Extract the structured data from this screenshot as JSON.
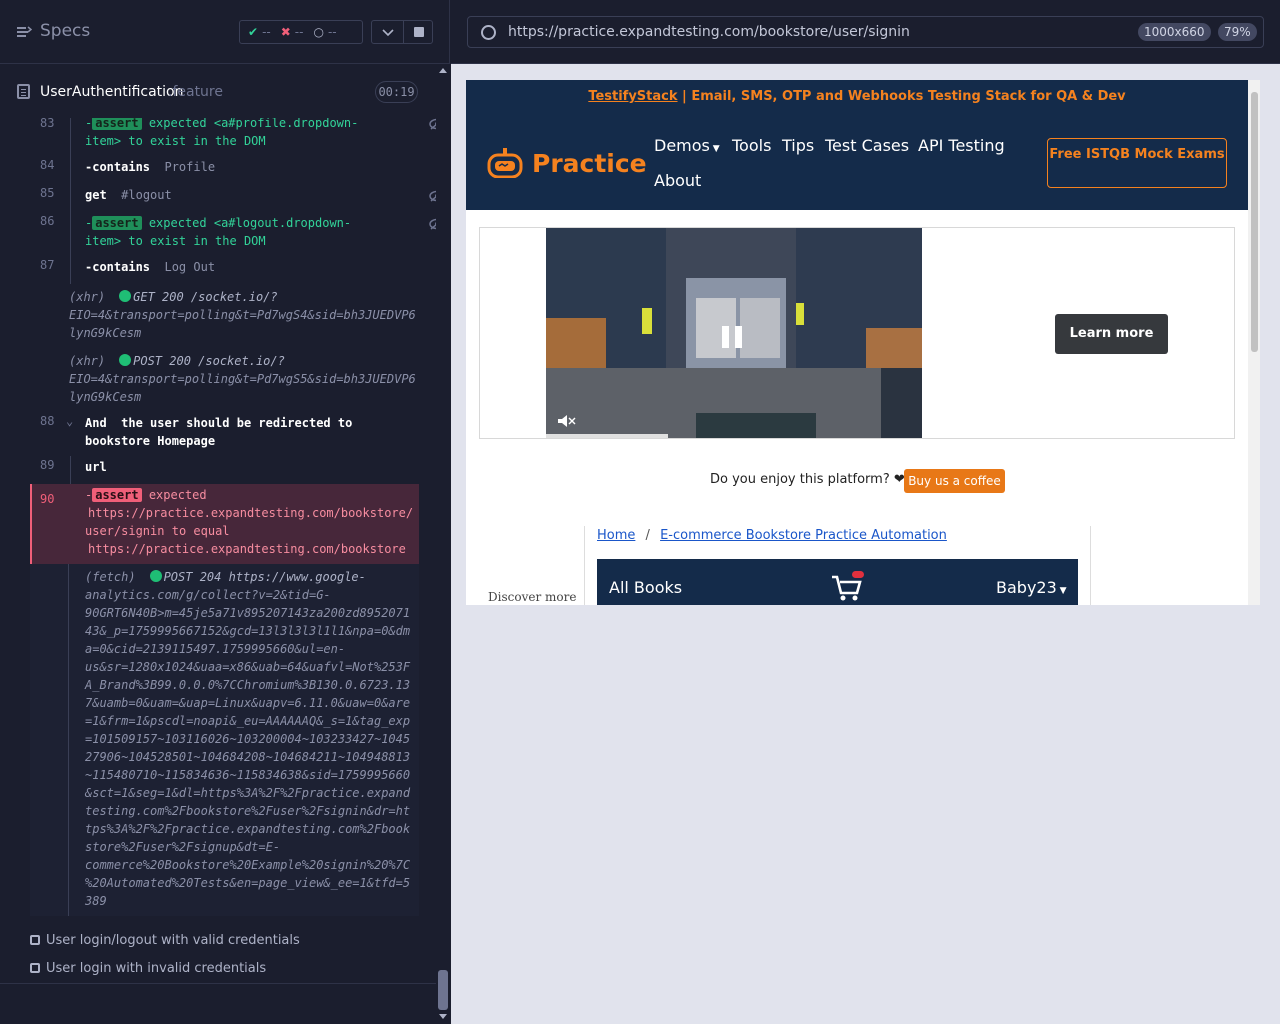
{
  "specs": {
    "title": "Specs",
    "passed": "--",
    "failed": "--",
    "pending": "--"
  },
  "file": {
    "name": "UserAuthentification",
    "ext": ".feature",
    "duration": "00:19"
  },
  "commands": [
    {
      "num": "83",
      "assert": "assert",
      "text": "expected",
      "code": "<a#profile.dropdown-",
      "code2": "item>",
      "tail": "to exist in the DOM"
    },
    {
      "num": "84",
      "cmd": "contains",
      "arg": "Profile"
    },
    {
      "num": "85",
      "cmd": "get",
      "arg": "#logout"
    },
    {
      "num": "86",
      "assert": "assert",
      "text": "expected",
      "code": "<a#logout.dropdown-",
      "code2": "item>",
      "tail": "to exist in the DOM"
    },
    {
      "num": "87",
      "cmd": "contains",
      "arg": "Log Out"
    }
  ],
  "xhr1": {
    "label": "(xhr)",
    "method": "GET 200 /socket.io/?",
    "line2": "EIO=4&transport=polling&t=Pd7wgS4&sid=bh3JUEDVP6",
    "line3": "lynG9kCesm"
  },
  "xhr2": {
    "label": "(xhr)",
    "method": "POST 200 /socket.io/?",
    "line2": "EIO=4&transport=polling&t=Pd7wgS5&sid=bh3JUEDVP6",
    "line3": "lynG9kCesm"
  },
  "step88": {
    "num": "88",
    "keyword": "And",
    "text1": "the user should be redirected to",
    "text2": "bookstore Homepage"
  },
  "step89": {
    "num": "89",
    "cmd": "url"
  },
  "fail90": {
    "num": "90",
    "assert": "assert",
    "expected": "expected",
    "url1a": "https://practice.expandtesting.com/bookstore/",
    "url1b": "user/signin",
    "toequal": "to equal",
    "url2": "https://practice.expandtesting.com/bookstore"
  },
  "fetch": {
    "label": "(fetch)",
    "first": "POST 204 https://www.google-",
    "lines": [
      "analytics.com/g/collect?v=2&tid=G-",
      "90GRT6N40B>m=45je5a71v895207143za200zd8952071",
      "43&_p=1759995667152&gcd=13l3l3l3l1l1&npa=0&dm",
      "a=0&cid=2139115497.1759995660&ul=en-",
      "us&sr=1280x1024&uaa=x86&uab=64&uafvl=Not%253F",
      "A_Brand%3B99.0.0.0%7CChromium%3B130.0.6723.13",
      "7&uamb=0&uam=&uap=Linux&uapv=6.11.0&uaw=0&are",
      "=1&frm=1&pscdl=noapi&_eu=AAAAAAQ&_s=1&tag_exp",
      "=101509157~103116026~103200004~103233427~1045",
      "27906~104528501~104684208~104684211~104948813",
      "~115480710~115834636~115834638&sid=1759995660",
      "&sct=1&seg=1&dl=https%3A%2F%2Fpractice.expand",
      "testing.com%2Fbookstore%2Fuser%2Fsignin&dr=ht",
      "tps%3A%2F%2Fpractice.expandtesting.com%2Fbook",
      "store%2Fuser%2Fsignup&dt=E-",
      "commerce%20Bookstore%20Example%20signin%20%7C",
      "%20Automated%20Tests&en=page_view&_ee=1&tfd=5",
      "389"
    ]
  },
  "tests": [
    "User login/logout with valid credentials",
    "User login with invalid credentials"
  ],
  "browser": {
    "url": "https://practice.expandtesting.com/bookstore/user/signin",
    "viewport": "1000x660",
    "zoom": "79%"
  },
  "site": {
    "banner_link": "TestifyStack",
    "banner_rest": " | Email, SMS, OTP and Webhooks Testing Stack for QA & Dev",
    "logo": "Practice",
    "nav": [
      "Demos",
      "Tools",
      "Tips",
      "Test Cases",
      "API Testing",
      "About"
    ],
    "cta": "Free ISTQB Mock Exams",
    "learn_more": "Learn more",
    "enjoy": "Do you enjoy this platform? ❤",
    "coffee": "Buy us a coffee",
    "crumb_home": "Home",
    "crumb_sep": "/",
    "crumb_page": "E-commerce Bookstore Practice Automation",
    "discover": "Discover more",
    "all_books": "All Books",
    "username": "Baby23"
  },
  "colors": {
    "accent_orange": "#f5821f",
    "navy": "#142b4a",
    "pass": "#32d399",
    "fail": "#f05f79"
  }
}
